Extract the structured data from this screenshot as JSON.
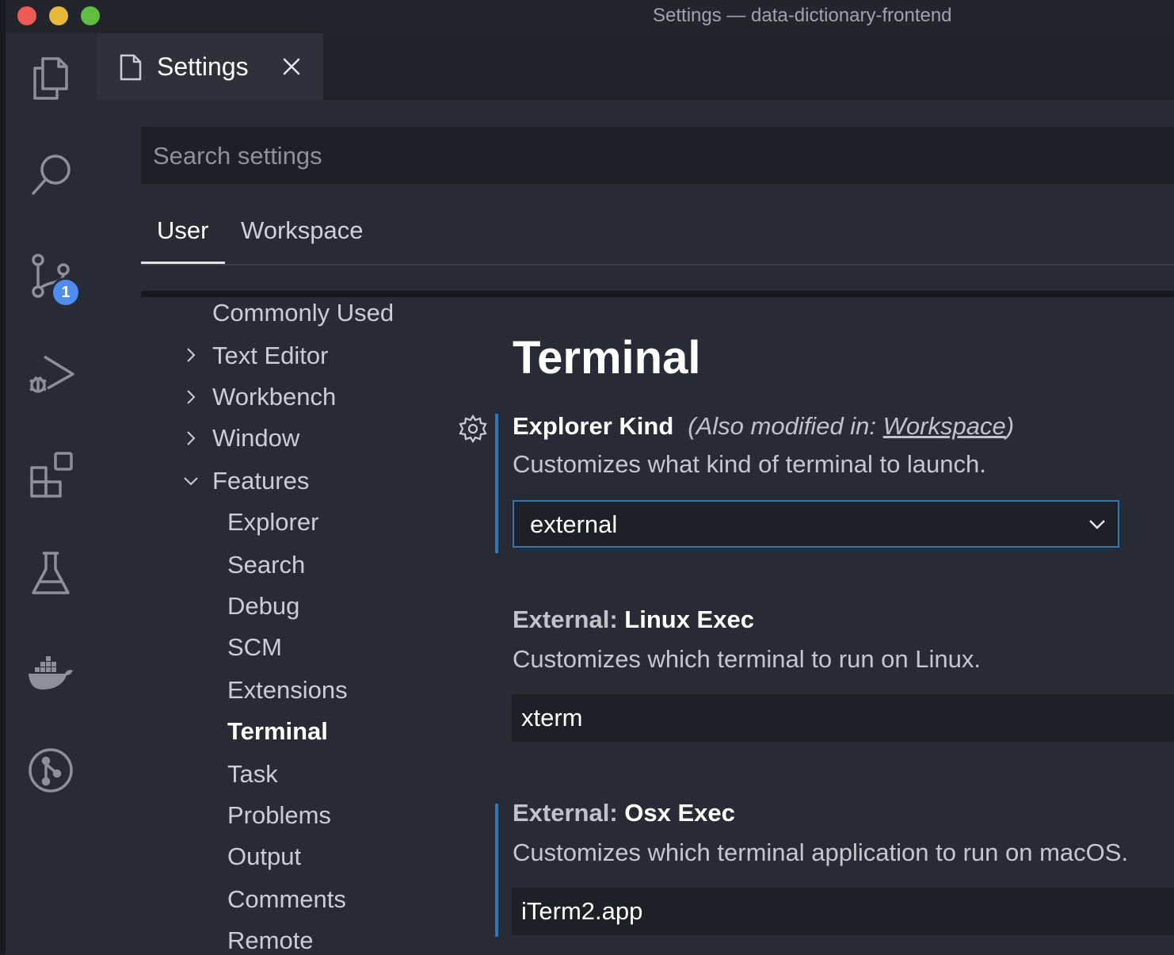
{
  "window": {
    "title": "Settings — data-dictionary-frontend",
    "traffic_lights": {
      "close": "#ee5b55",
      "minimize": "#e6b93c",
      "maximize": "#5fbe42"
    }
  },
  "activity_bar": {
    "items": [
      {
        "icon": "files-icon"
      },
      {
        "icon": "search-icon"
      },
      {
        "icon": "source-control-icon",
        "badge": "1"
      },
      {
        "icon": "run-debug-icon"
      },
      {
        "icon": "extensions-icon"
      },
      {
        "icon": "testing-flask-icon"
      },
      {
        "icon": "docker-icon"
      },
      {
        "icon": "gitlens-icon"
      }
    ]
  },
  "tab": {
    "label": "Settings",
    "icon": "file-icon",
    "close_icon": "close-icon"
  },
  "search": {
    "placeholder": "Search settings",
    "value": ""
  },
  "scopes": {
    "user": "User",
    "workspace": "Workspace",
    "active": "User"
  },
  "toc": {
    "commonly_used": "Commonly Used",
    "text_editor": "Text Editor",
    "workbench": "Workbench",
    "window": "Window",
    "features": "Features",
    "children": [
      "Explorer",
      "Search",
      "Debug",
      "SCM",
      "Extensions",
      "Terminal",
      "Task",
      "Problems",
      "Output",
      "Comments",
      "Remote"
    ],
    "active": "Terminal"
  },
  "section": {
    "title": "Terminal"
  },
  "settings": {
    "explorer_kind": {
      "name": "Explorer Kind",
      "also_prefix": "(Also modified in: ",
      "also_link": "Workspace",
      "also_suffix": ")",
      "description": "Customizes what kind of terminal to launch.",
      "value": "external"
    },
    "linux_exec": {
      "category": "External: ",
      "name": "Linux Exec",
      "description": "Customizes which terminal to run on Linux.",
      "value": "xterm"
    },
    "osx_exec": {
      "category": "External: ",
      "name": "Osx Exec",
      "description": "Customizes which terminal application to run on macOS.",
      "value": "iTerm2.app"
    }
  },
  "colors": {
    "accent": "#2f77b7",
    "badge": "#4d8cf0",
    "background": "#272b35",
    "input_bg": "#1e2027"
  }
}
